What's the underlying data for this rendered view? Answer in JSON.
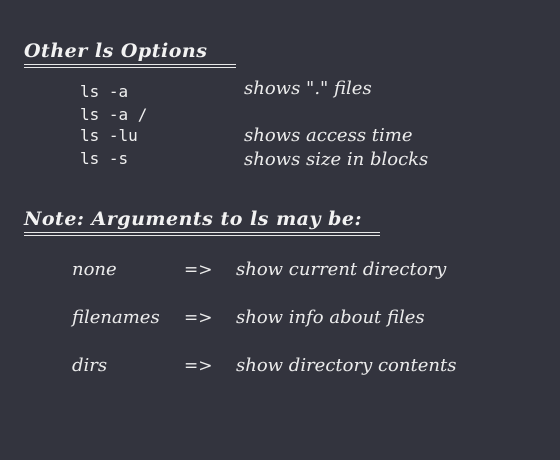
{
  "options_section": {
    "heading": "Other ls Options",
    "rows": [
      {
        "command": "ls -a",
        "description": "shows \".\" files"
      },
      {
        "command": "ls -a /",
        "description": ""
      },
      {
        "command": "ls -lu",
        "description": "shows access time"
      },
      {
        "command": "ls -s",
        "description": "shows size in blocks"
      }
    ]
  },
  "arguments_section": {
    "heading": "Note: Arguments to ls may be:",
    "rows": [
      {
        "name": "none",
        "arrow": "=>",
        "description": "show current directory"
      },
      {
        "name": "filenames",
        "arrow": "=>",
        "description": "show info about files"
      },
      {
        "name": "dirs",
        "arrow": "=>",
        "description": "show directory contents"
      }
    ]
  }
}
